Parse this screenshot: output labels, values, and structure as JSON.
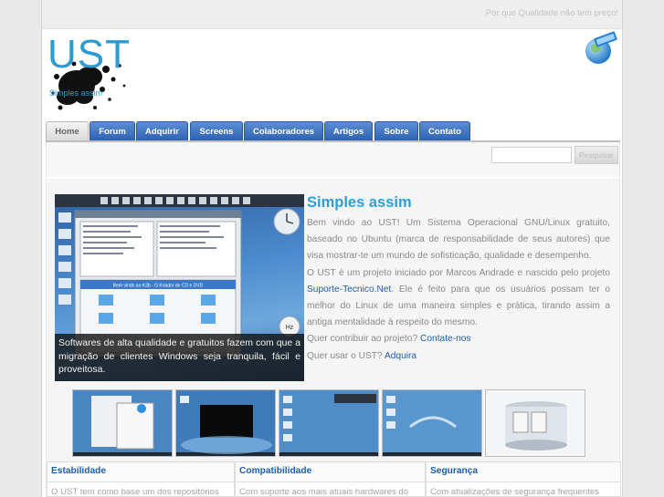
{
  "topbar": {
    "tagline": "Por que Qualidade não tem preço!"
  },
  "header": {
    "logo_text": "UST",
    "logo_subtext": "Simples assim"
  },
  "nav": {
    "tabs": [
      {
        "label": "Home",
        "active": true
      },
      {
        "label": "Forum"
      },
      {
        "label": "Adquirir"
      },
      {
        "label": "Screens"
      },
      {
        "label": "Colaboradores"
      },
      {
        "label": "Artigos"
      },
      {
        "label": "Sobre"
      },
      {
        "label": "Contato"
      }
    ]
  },
  "search": {
    "placeholder": "",
    "button_label": "Pesquisar"
  },
  "feature": {
    "caption": "Softwares de alta qualidade e gratuitos fazem com que a migração de clientes Windows seja tranquila, fácil e proveitosa.",
    "desktop_banner": "Bem vindo ao K3b - O Kriador de CD e DVD"
  },
  "article": {
    "title": "Simples assim",
    "p1": "Bem vindo ao UST! Um Sistema Operacional GNU/Linux gratuito, baseado no Ubuntu (marca de responsabilidade de seus autores) que visa mostrar-te um mundo de sofisticação, qualidade e desempenho.",
    "p2_before": "O UST é um projeto iniciado por Marcos Andrade e nascido pelo projeto ",
    "p2_link": "Suporte-Tecnico.Net",
    "p2_after": ". Ele é feito para que os usuários possam ter o melhor do Linux de uma maneira simples e prática, tirando assim a antiga mentalidade à respeito do mesmo.",
    "p3_before": "Quer contribuir ao projeto? ",
    "p3_link": "Contate-nos",
    "p4_before": "Quer usar o UST? ",
    "p4_link": "Adquira"
  },
  "thumbnails": [
    {
      "name": "thumbnail-1"
    },
    {
      "name": "thumbnail-2"
    },
    {
      "name": "thumbnail-3"
    },
    {
      "name": "thumbnail-4"
    },
    {
      "name": "thumbnail-5"
    }
  ],
  "columns": [
    {
      "title": "Estabilidade",
      "text": "O UST tem como base um dos repositórios"
    },
    {
      "title": "Compatibilidade",
      "text": "Com suporte aos mais atuais hardwares do"
    },
    {
      "title": "Segurança",
      "text": "Com atualizações de segurança frequentes"
    }
  ],
  "colors": {
    "accent": "#2e9fd6",
    "link": "#1d5ea8",
    "tab": "#3a6dbe"
  }
}
